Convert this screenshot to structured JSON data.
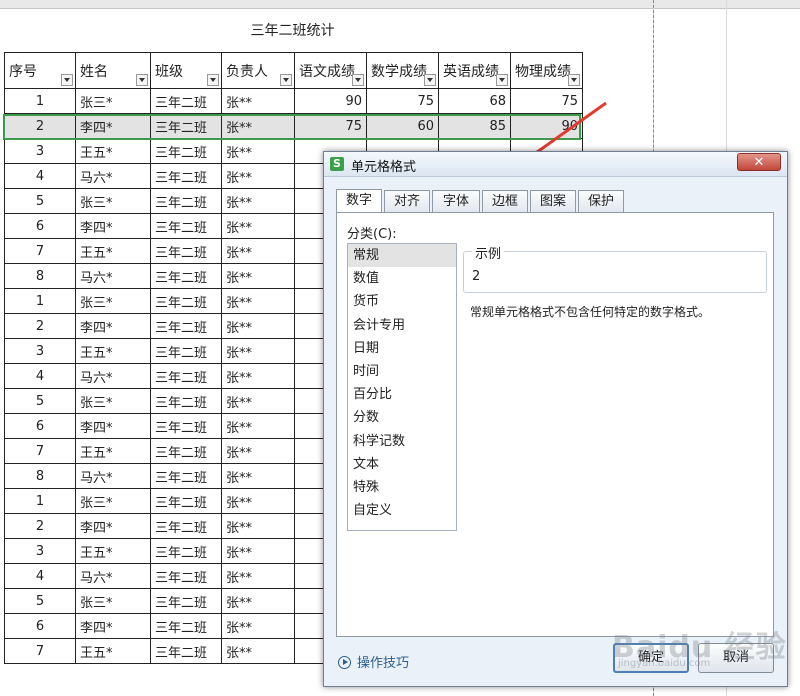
{
  "sheet": {
    "title": "三年二班统计",
    "headers": [
      "序号",
      "姓名",
      "班级",
      "负责人",
      "语文成绩",
      "数学成绩",
      "英语成绩",
      "物理成绩"
    ],
    "rows": [
      [
        "1",
        "张三*",
        "三年二班",
        "张**",
        "90",
        "75",
        "68",
        "75"
      ],
      [
        "2",
        "李四*",
        "三年二班",
        "张**",
        "75",
        "60",
        "85",
        "90"
      ],
      [
        "3",
        "王五*",
        "三年二班",
        "张**",
        "",
        "",
        "",
        ""
      ],
      [
        "4",
        "马六*",
        "三年二班",
        "张**",
        "",
        "",
        "",
        ""
      ],
      [
        "5",
        "张三*",
        "三年二班",
        "张**",
        "",
        "",
        "",
        ""
      ],
      [
        "6",
        "李四*",
        "三年二班",
        "张**",
        "",
        "",
        "",
        ""
      ],
      [
        "7",
        "王五*",
        "三年二班",
        "张**",
        "",
        "",
        "",
        ""
      ],
      [
        "8",
        "马六*",
        "三年二班",
        "张**",
        "",
        "",
        "",
        ""
      ],
      [
        "1",
        "张三*",
        "三年二班",
        "张**",
        "",
        "",
        "",
        ""
      ],
      [
        "2",
        "李四*",
        "三年二班",
        "张**",
        "",
        "",
        "",
        ""
      ],
      [
        "3",
        "王五*",
        "三年二班",
        "张**",
        "",
        "",
        "",
        ""
      ],
      [
        "4",
        "马六*",
        "三年二班",
        "张**",
        "",
        "",
        "",
        ""
      ],
      [
        "5",
        "张三*",
        "三年二班",
        "张**",
        "",
        "",
        "",
        ""
      ],
      [
        "6",
        "李四*",
        "三年二班",
        "张**",
        "",
        "",
        "",
        ""
      ],
      [
        "7",
        "王五*",
        "三年二班",
        "张**",
        "",
        "",
        "",
        ""
      ],
      [
        "8",
        "马六*",
        "三年二班",
        "张**",
        "",
        "",
        "",
        ""
      ],
      [
        "1",
        "张三*",
        "三年二班",
        "张**",
        "",
        "",
        "",
        ""
      ],
      [
        "2",
        "李四*",
        "三年二班",
        "张**",
        "",
        "",
        "",
        ""
      ],
      [
        "3",
        "王五*",
        "三年二班",
        "张**",
        "",
        "",
        "",
        ""
      ],
      [
        "4",
        "马六*",
        "三年二班",
        "张**",
        "",
        "",
        "",
        ""
      ],
      [
        "5",
        "张三*",
        "三年二班",
        "张**",
        "",
        "",
        "",
        ""
      ],
      [
        "6",
        "李四*",
        "三年二班",
        "张**",
        "",
        "",
        "",
        ""
      ],
      [
        "7",
        "王五*",
        "三年二班",
        "张**",
        "",
        "",
        "",
        ""
      ]
    ],
    "selected_row": 1,
    "selection_color": "#3c9a4a"
  },
  "dialog": {
    "title": "单元格格式",
    "app_icon": "S",
    "close_label": "✕",
    "tabs": [
      "数字",
      "对齐",
      "字体",
      "边框",
      "图案",
      "保护"
    ],
    "active_tab": 0,
    "category_label": "分类(C):",
    "categories": [
      "常规",
      "数值",
      "货币",
      "会计专用",
      "日期",
      "时间",
      "百分比",
      "分数",
      "科学记数",
      "文本",
      "特殊",
      "自定义"
    ],
    "active_category": 0,
    "sample_label": "示例",
    "sample_value": "2",
    "description": "常规单元格格式不包含任何特定的数字格式。",
    "tips_label": "操作技巧",
    "ok_label": "确定",
    "cancel_label": "取消"
  },
  "annotation": {
    "arrow_color": "#e23b2e",
    "points_to": "tab-font"
  },
  "watermark": {
    "main": "Baidu 经验",
    "sub": "jingyan.baidu.com"
  }
}
